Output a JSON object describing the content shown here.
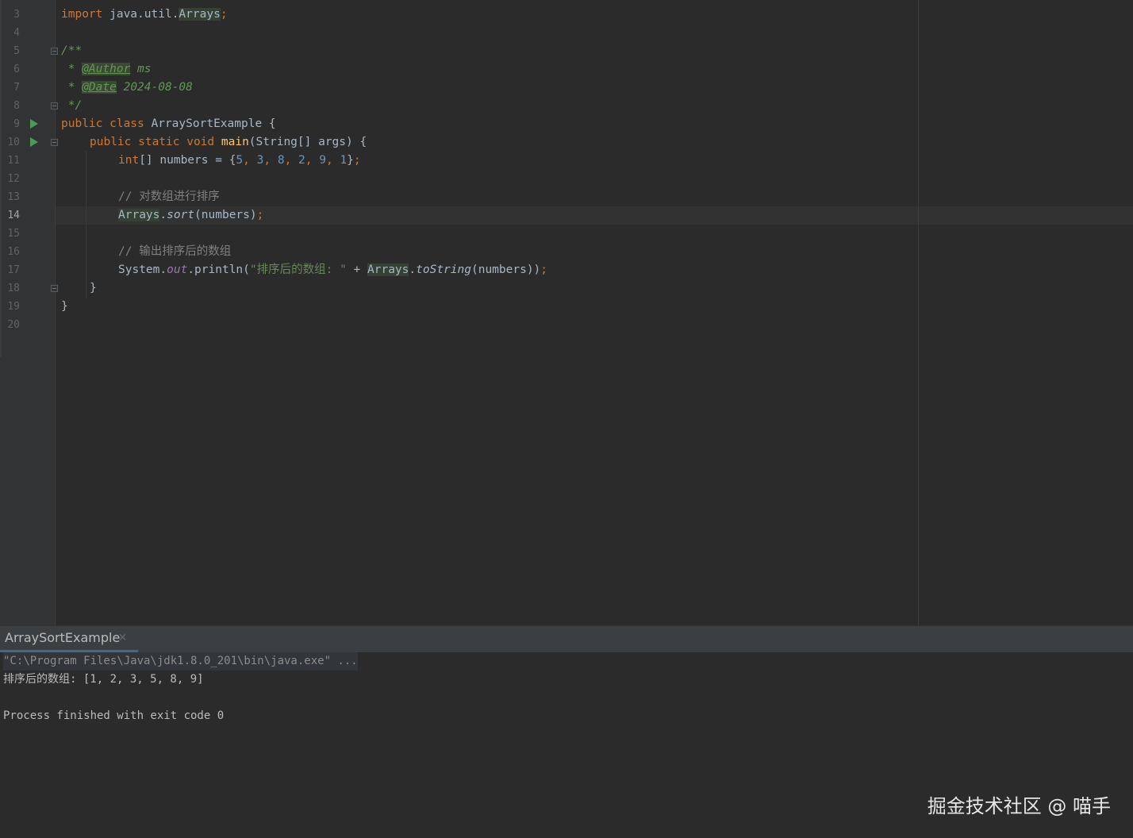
{
  "editor": {
    "current_line": "14",
    "line_numbers": [
      "3",
      "4",
      "5",
      "6",
      "7",
      "8",
      "9",
      "10",
      "11",
      "12",
      "13",
      "14",
      "15",
      "16",
      "17",
      "18",
      "19",
      "20"
    ],
    "code": {
      "import_kw": "import",
      "import_pkg": " java.util.",
      "import_class": "Arrays",
      "import_semi": ";",
      "doc_open": "/**",
      "doc_star1": " * ",
      "author_tag": "@Author",
      "author_val": " ms",
      "doc_star2": " * ",
      "date_tag": "@Date",
      "date_val": " 2024-08-08",
      "doc_close": " */",
      "class_kw": "public class",
      "class_name": " ArraySortExample {",
      "main_kw": "public static void",
      "main_name": "main",
      "main_params": "(String[] args) {",
      "int_kw": "int",
      "int_decl": "[] numbers = {",
      "nums": [
        "5",
        "3",
        "8",
        "2",
        "9",
        "1"
      ],
      "int_end": "}",
      "semi": ";",
      "comment1": "// 对数组进行排序",
      "sort_class": "Arrays",
      "sort_dot": ".",
      "sort_method": "sort",
      "sort_args": "(numbers)",
      "comment2": "// 输出排序后的数组",
      "sys": "System.",
      "out": "out",
      "println": ".println(",
      "str": "\"排序后的数组: \"",
      "plus": " + ",
      "tostr_class": "Arrays",
      "tostr_dot": ".",
      "tostr_method": "toString",
      "tostr_args": "(numbers))",
      "close_method": "}",
      "close_class": "}"
    }
  },
  "run_panel": {
    "tab_label": "ArraySortExample",
    "tab_close": "×",
    "console": {
      "command": "\"C:\\Program Files\\Java\\jdk1.8.0_201\\bin\\java.exe\" ...",
      "output": "排序后的数组: [1, 2, 3, 5, 8, 9]",
      "exit": "Process finished with exit code 0"
    }
  },
  "watermark": "掘金技术社区 @ 喵手",
  "colors": {
    "background": "#2b2b2b",
    "keyword": "#cc7832",
    "number": "#6897bb",
    "string": "#6a8759",
    "comment": "#808080",
    "doc_comment": "#629755",
    "method": "#ffc66d",
    "run_icon": "#499c54"
  }
}
